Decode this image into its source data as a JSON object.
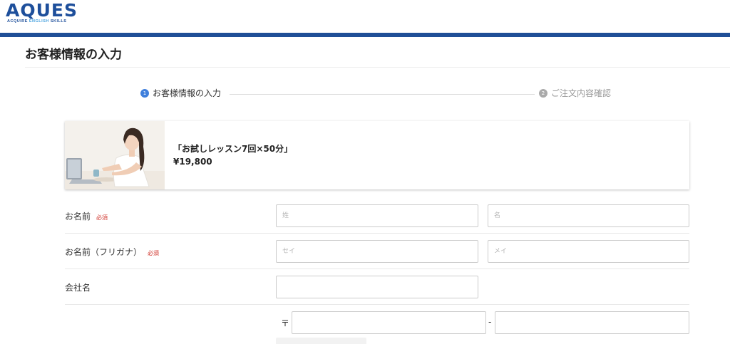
{
  "header": {
    "logo_text": "AQUES",
    "logo_sub_1": "ACQUIRE ",
    "logo_sub_2": "ENGLISH",
    "logo_sub_3": " SKILLS",
    "accent_color": "#1f4f97"
  },
  "page": {
    "title": "お客様情報の入力"
  },
  "steps": [
    {
      "num": "1",
      "label": "お客様情報の入力",
      "state": "active"
    },
    {
      "num": "2",
      "label": "ご注文内容確認",
      "state": "inactive"
    }
  ],
  "product": {
    "name": "「お試しレッスン7回×50分」",
    "price": "¥19,800"
  },
  "form": {
    "name": {
      "label": "お名前",
      "required": "必須",
      "last_placeholder": "姓",
      "first_placeholder": "名"
    },
    "kana": {
      "label": "お名前（フリガナ）",
      "required": "必須",
      "last_placeholder": "セイ",
      "first_placeholder": "メイ"
    },
    "company": {
      "label": "会社名"
    },
    "postal": {
      "mark": "〒",
      "dash": "-"
    }
  },
  "colors": {
    "step_active": "#3f7fdc",
    "required": "#d0342c"
  }
}
